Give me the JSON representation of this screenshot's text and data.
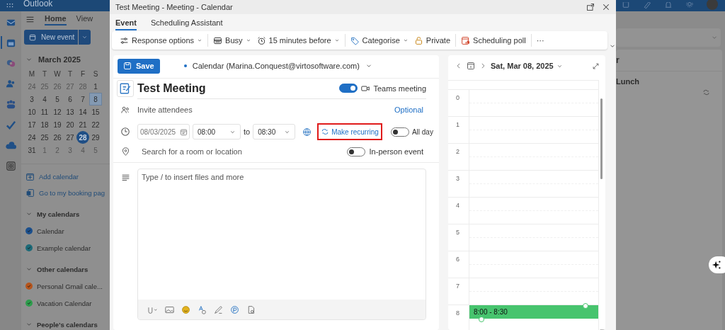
{
  "app": {
    "title": "Outlook"
  },
  "rail": [
    {
      "kind": "mail",
      "selected": false
    },
    {
      "kind": "calendar",
      "selected": true
    },
    {
      "kind": "copilot",
      "selected": false
    },
    {
      "kind": "people",
      "selected": false
    },
    {
      "kind": "teams",
      "selected": false
    },
    {
      "kind": "todo",
      "selected": false
    },
    {
      "kind": "onedrive",
      "selected": false
    },
    {
      "kind": "apps",
      "selected": false
    }
  ],
  "sidebar": {
    "tabs": [
      {
        "label": "Home",
        "selected": true
      },
      {
        "label": "View",
        "selected": false
      }
    ],
    "new_event": "New event",
    "mini_calendar": {
      "month": "March 2025",
      "weekdays": [
        "M",
        "T",
        "W",
        "T",
        "F",
        "S"
      ],
      "weeks": [
        [
          {
            "d": "24",
            "outside": true,
            "selected": false,
            "today": false
          },
          {
            "d": "25",
            "outside": true,
            "selected": false,
            "today": false
          },
          {
            "d": "26",
            "outside": true,
            "selected": false,
            "today": false
          },
          {
            "d": "27",
            "outside": true,
            "selected": false,
            "today": false
          },
          {
            "d": "28",
            "outside": true,
            "selected": false,
            "today": false
          },
          {
            "d": "1",
            "outside": false,
            "selected": false,
            "today": false
          }
        ],
        [
          {
            "d": "3",
            "outside": false,
            "selected": false,
            "today": false
          },
          {
            "d": "4",
            "outside": false,
            "selected": false,
            "today": false
          },
          {
            "d": "5",
            "outside": false,
            "selected": false,
            "today": false
          },
          {
            "d": "6",
            "outside": false,
            "selected": false,
            "today": false
          },
          {
            "d": "7",
            "outside": false,
            "selected": false,
            "today": false
          },
          {
            "d": "8",
            "outside": false,
            "selected": true,
            "today": false
          }
        ],
        [
          {
            "d": "10",
            "outside": false,
            "selected": false,
            "today": false
          },
          {
            "d": "11",
            "outside": false,
            "selected": false,
            "today": false
          },
          {
            "d": "12",
            "outside": false,
            "selected": false,
            "today": false
          },
          {
            "d": "13",
            "outside": false,
            "selected": false,
            "today": false
          },
          {
            "d": "14",
            "outside": false,
            "selected": false,
            "today": false
          },
          {
            "d": "15",
            "outside": false,
            "selected": false,
            "today": false
          }
        ],
        [
          {
            "d": "17",
            "outside": false,
            "selected": false,
            "today": false
          },
          {
            "d": "18",
            "outside": false,
            "selected": false,
            "today": false
          },
          {
            "d": "19",
            "outside": false,
            "selected": false,
            "today": false
          },
          {
            "d": "20",
            "outside": false,
            "selected": false,
            "today": false
          },
          {
            "d": "21",
            "outside": false,
            "selected": false,
            "today": false
          },
          {
            "d": "22",
            "outside": false,
            "selected": false,
            "today": false
          }
        ],
        [
          {
            "d": "24",
            "outside": false,
            "selected": false,
            "today": false
          },
          {
            "d": "25",
            "outside": false,
            "selected": false,
            "today": false
          },
          {
            "d": "26",
            "outside": false,
            "selected": false,
            "today": false
          },
          {
            "d": "27",
            "outside": false,
            "selected": false,
            "today": false
          },
          {
            "d": "28",
            "outside": false,
            "selected": false,
            "today": true
          },
          {
            "d": "29",
            "outside": false,
            "selected": false,
            "today": false
          }
        ],
        [
          {
            "d": "31",
            "outside": false,
            "selected": false,
            "today": false
          },
          {
            "d": "1",
            "outside": true,
            "selected": false,
            "today": false
          },
          {
            "d": "2",
            "outside": true,
            "selected": false,
            "today": false
          },
          {
            "d": "3",
            "outside": true,
            "selected": false,
            "today": false
          },
          {
            "d": "4",
            "outside": true,
            "selected": false,
            "today": false
          },
          {
            "d": "5",
            "outside": true,
            "selected": false,
            "today": false
          }
        ]
      ]
    },
    "links": [
      {
        "label": "Add calendar",
        "kind": "add"
      },
      {
        "label": "Go to my booking pag",
        "kind": "booking"
      }
    ],
    "groups": [
      {
        "title": "My calendars",
        "expanded": true,
        "calendars": [
          {
            "name": "Calendar",
            "color": "#1b4f8c",
            "checked": true
          },
          {
            "name": "Example calendar",
            "color": "#1c6a78",
            "checked": true
          }
        ]
      },
      {
        "title": "Other calendars",
        "expanded": true,
        "calendars": [
          {
            "name": "Personal Gmail cale...",
            "color": "#b4541c",
            "checked": true
          },
          {
            "name": "Vacation Calendar",
            "color": "#2e9c4c",
            "checked": true
          }
        ]
      },
      {
        "title": "People's calendars",
        "expanded": true
      }
    ]
  },
  "background": {
    "heading": "r",
    "event": "Lunch"
  },
  "dialog": {
    "title": "Test Meeting - Meeting - Calendar",
    "tabs": [
      {
        "label": "Event",
        "selected": true
      },
      {
        "label": "Scheduling Assistant",
        "selected": false
      }
    ],
    "toolbar": [
      [
        {
          "label": "Response options",
          "kind": "menu"
        }
      ],
      [
        {
          "label": "Busy",
          "kind": "menu"
        },
        {
          "label": "15 minutes before",
          "kind": "menu"
        }
      ],
      [
        {
          "label": "Categorise",
          "kind": "menu"
        },
        {
          "label": "Private",
          "kind": "button"
        }
      ],
      [
        {
          "label": "Scheduling poll",
          "kind": "button"
        }
      ],
      [
        {
          "label": "···",
          "kind": "button"
        }
      ]
    ],
    "form": {
      "save": "Save",
      "calendar": "Calendar (Marina.Conquest@virtosoftware.com)",
      "title": "Test Meeting",
      "teams": {
        "label": "Teams meeting",
        "on": true
      },
      "attendees": {
        "placeholder": "Invite attendees"
      },
      "optional": "Optional",
      "date": "08/03/2025",
      "start": "08:00",
      "to": "to",
      "end": "08:30",
      "recurring": "Make recurring",
      "all_day": {
        "label": "All day",
        "on": false
      },
      "location": {
        "placeholder": "Search for a room or location"
      },
      "in_person": {
        "label": "In-person event",
        "on": false
      },
      "body": {
        "placeholder": "Type / to insert files and more"
      }
    },
    "schedule": {
      "date": "Sat, Mar 08, 2025",
      "hours": [
        "0",
        "1",
        "2",
        "3",
        "4",
        "5",
        "6",
        "7",
        "8"
      ],
      "event": {
        "label": "8:00 - 8:30"
      }
    }
  }
}
